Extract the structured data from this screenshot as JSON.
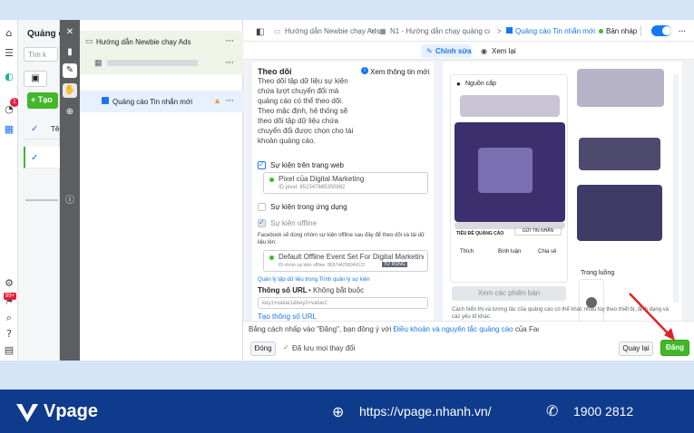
{
  "list_panel": {
    "title": "Quảng cá",
    "search_placeholder": "Tìm k",
    "create_label": "+ Tạo",
    "header_label": "Tên"
  },
  "tree": {
    "campaign": "Hướng dẫn Newbie chạy Ads",
    "ad": "Quảng cáo Tin nhắn mới",
    "more": "···"
  },
  "topbar": {
    "crumb1": "Hướng dẫn Newbie chạy Ads",
    "crumb2": "N1 - Hướng dẫn chạy quảng cáo ...",
    "crumb3": "Quảng cáo Tin nhắn mới",
    "draft": "Bản nháp",
    "sep": ">"
  },
  "tabs": {
    "edit": "Chỉnh sửa",
    "preview": "Xem lại"
  },
  "editor": {
    "section_title": "Theo dõi",
    "view_more": "Xem thông tin mới",
    "description": "Theo dõi tập dữ liệu sự kiện chứa lượt chuyển đổi mà quảng cáo có thể theo dõi. Theo mặc định, hệ thống sẽ theo dõi tập dữ liệu chứa chuyển đổi được chọn cho tài khoản quảng cáo.",
    "web_events": "Sự kiện trên trang web",
    "pixel_name": "Pixel của Digital Marketing",
    "pixel_id": "ID pixel: 852347665350862",
    "app_events": "Sự kiện trong ứng dụng",
    "offline_events": "Sự kiện offline",
    "offline_note": "Facebook sẽ dùng nhóm sự kiện offline sau đây để theo dõi và tải dữ liệu lên:",
    "offline_set": "Default Offline Event Set For Digital Marketing I...",
    "offline_id": "ID nhóm sự kiện offline: 869744296944137",
    "offline_badge": "TỪ RỘNG",
    "manage_link": "Quản lý tập dữ liệu trong Trình quản lý sự kiện",
    "url_params_label": "Thông số URL",
    "url_params_optional": "• Không bắt buộc",
    "url_params_placeholder": "key1=value1&key2=value2",
    "build_params": "Tạo thông số URL"
  },
  "preview": {
    "page_name": "Nguồn cấp",
    "cta_title": "TIÊU ĐỀ QUẢNG CÁO",
    "cta_button": "GỬI TIN NHẮN",
    "like": "Thích",
    "comment": "Bình luận",
    "share": "Chia sẻ",
    "view_variants": "Xem các phiên bản",
    "placement": "Trong luồng",
    "note": "Cách hiển thị và tương tác của quảng cáo có thể khác nhau tùy theo thiết bị, định dạng và các yếu tố khác."
  },
  "footer": {
    "notice_prefix": "Bằng cách nhấp vào \"Đăng\", bạn đồng ý với",
    "terms_link": "Điều khoản và nguyên tắc quảng cáo",
    "notice_suffix": "của Facebook.",
    "close": "Đóng",
    "saved": "Đã lưu mọi thay đổi",
    "back": "Quay lại",
    "publish": "Đăng"
  },
  "branding": {
    "logo": "Vpage",
    "url": "https://vpage.nhanh.vn/",
    "phone": "1900 2812"
  },
  "notification_count": "1",
  "badge_99": "99+",
  "colors": {
    "accent": "#1877f2",
    "green": "#42b72a",
    "brand_bar": "#0f3b8c",
    "arrow": "#e02424"
  }
}
